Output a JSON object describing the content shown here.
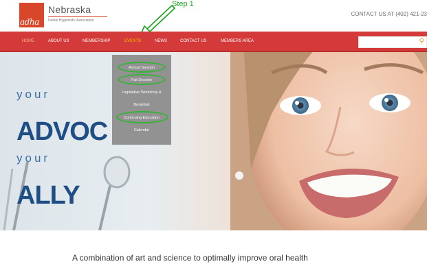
{
  "brand": {
    "mark": "adha",
    "title": "Nebraska",
    "subtitle": "Dental Hygienists' Association"
  },
  "header": {
    "contact": "CONTACT US AT (402) 421-23"
  },
  "annotation": {
    "label": "Step 1"
  },
  "nav": {
    "items": [
      {
        "label": "HOME"
      },
      {
        "label": "ABOUT US"
      },
      {
        "label": "MEMBERSHIP"
      },
      {
        "label": "EVENTS"
      },
      {
        "label": "NEWS"
      },
      {
        "label": "CONTACT US"
      },
      {
        "label": "MEMBERS AREA"
      }
    ],
    "search": {
      "placeholder": "",
      "icon": "search-icon"
    }
  },
  "dropdown": {
    "items": [
      {
        "label": "Annual Session",
        "highlighted": true
      },
      {
        "label": "Fall Session",
        "highlighted": true
      },
      {
        "label": "Legislative Workshop &",
        "highlighted": false
      },
      {
        "label": "Breakfast",
        "highlighted": false
      },
      {
        "label": "Continuing Education",
        "highlighted": true
      },
      {
        "label": "Calendar",
        "highlighted": false
      }
    ]
  },
  "hero": {
    "line1": "your",
    "line2": "ADVOC",
    "line3": "your",
    "line4": "ALLY"
  },
  "tagline": "A combination of art and science to optimally improve oral health",
  "colors": {
    "nav": "#d53a3a",
    "accent": "#f4c300",
    "highlight_ring": "#2fb02f",
    "hero_text": "#1f4e86"
  }
}
